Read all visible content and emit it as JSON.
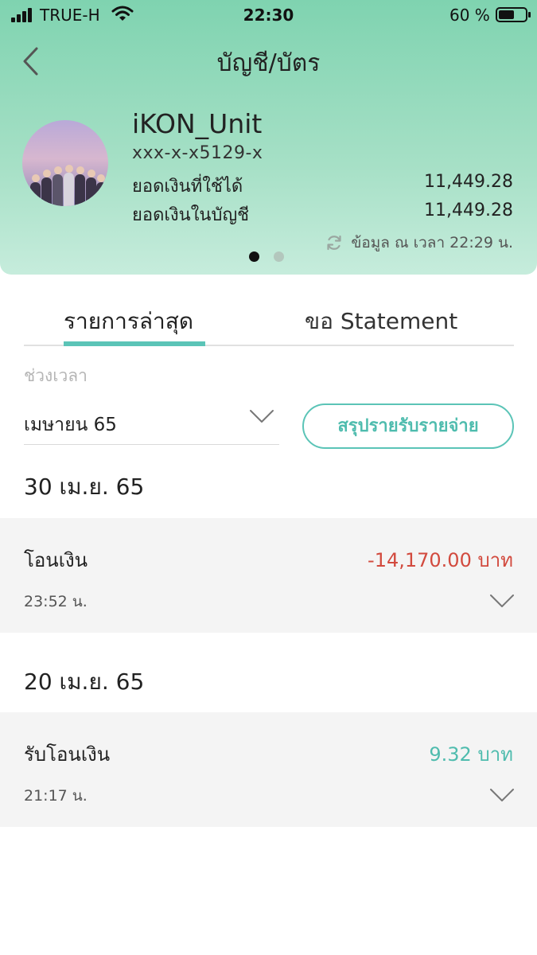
{
  "status_bar": {
    "carrier": "TRUE-H",
    "time": "22:30",
    "battery_percent": "60 %",
    "battery_level": 0.6
  },
  "nav": {
    "title": "บัญชี/บัตร"
  },
  "account": {
    "name": "iKON_Unit",
    "number": "xxx-x-x5129-x",
    "available_label": "ยอดเงินที่ใช้ได้",
    "available_value": "11,449.28",
    "balance_label": "ยอดเงินในบัญชี",
    "balance_value": "11,449.28",
    "updated_text": "ข้อมูล ณ เวลา 22:29 น.",
    "carousel_pages": 2,
    "carousel_active": 1
  },
  "tabs": {
    "recent": "รายการล่าสุด",
    "statement": "ขอ Statement"
  },
  "filter": {
    "period_label": "ช่วงเวลา",
    "month_value": "เมษายน 65",
    "summary_button": "สรุปรายรับรายจ่าย"
  },
  "transactions": [
    {
      "date": "30 เม.ย. 65",
      "title": "โอนเงิน",
      "amount": "-14,170.00 บาท",
      "time": "23:52 น."
    },
    {
      "date": "20 เม.ย. 65",
      "title": "รับโอนเงิน",
      "amount": "9.32 บาท",
      "time": "21:17 น."
    }
  ],
  "colors": {
    "header_gradient_top": "#7fd3b0",
    "header_gradient_bottom": "#c6ecdc",
    "accent_teal": "#5bc4b7",
    "negative_amount": "#d24a3e",
    "positive_amount": "#4fbcae"
  },
  "icons": {
    "back": "chevron-left-icon",
    "signal": "cellular-signal-icon",
    "wifi": "wifi-icon",
    "battery": "battery-icon",
    "refresh": "refresh-icon",
    "dropdown": "chevron-down-icon"
  }
}
